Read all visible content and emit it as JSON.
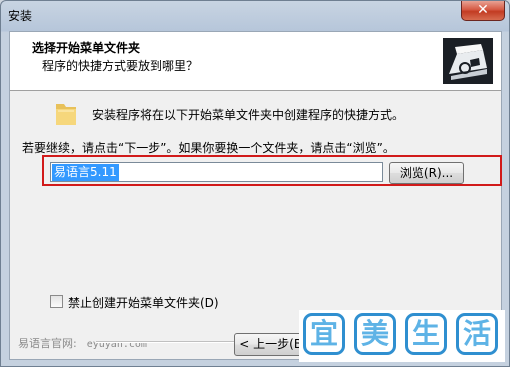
{
  "window": {
    "title": "安装",
    "close_glyph": "✕"
  },
  "header": {
    "title": "选择开始菜单文件夹",
    "subtitle": "程序的快捷方式要放到哪里？",
    "logo_icon": "installer-box-icon"
  },
  "body": {
    "info_text": "安装程序将在以下开始菜单文件夹中创建程序的快捷方式。",
    "instruction_text": "若要继续，请点击“下一步”。如果你要换一个文件夹，请点击“浏览”。",
    "folder_input_value": "易语言5.11",
    "browse_label": "浏览(R)...",
    "checkbox_label": "禁止创建开始菜单文件夹(D)",
    "checkbox_checked": false,
    "highlight_color": "#d11a1a"
  },
  "footer": {
    "brand": "易语言官网:",
    "brand_url": "eyuyan.com",
    "back_label": "< 上一步(B)"
  },
  "watermark": {
    "chars": [
      "宜",
      "美",
      "生",
      "活"
    ],
    "color": "#2f8fd0"
  }
}
